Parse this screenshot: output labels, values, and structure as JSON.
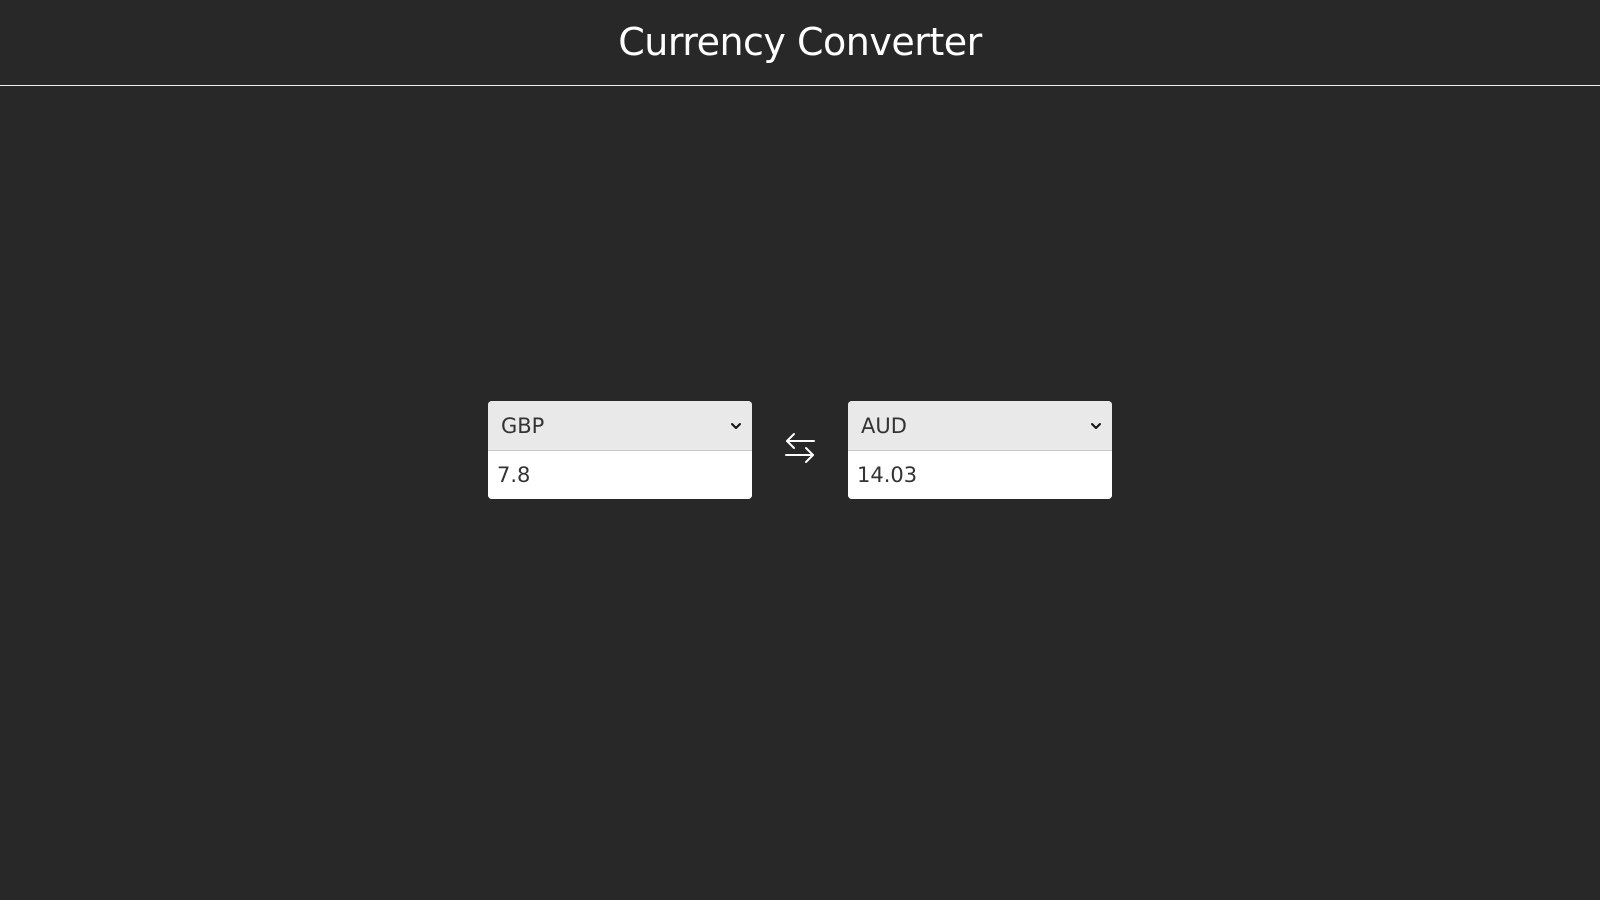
{
  "header": {
    "title": "Currency Converter"
  },
  "converter": {
    "from": {
      "currency": "GBP",
      "amount": "7.8"
    },
    "to": {
      "currency": "AUD",
      "amount": "14.03"
    },
    "swap_icon": "swap-arrows-icon",
    "dropdown_icon": "chevron-down-icon"
  },
  "colors": {
    "background": "#282828",
    "header_border": "#f0f0f0",
    "select_bg": "#e9e9e9",
    "input_bg": "#ffffff",
    "text": "#333333",
    "title": "#ffffff"
  }
}
